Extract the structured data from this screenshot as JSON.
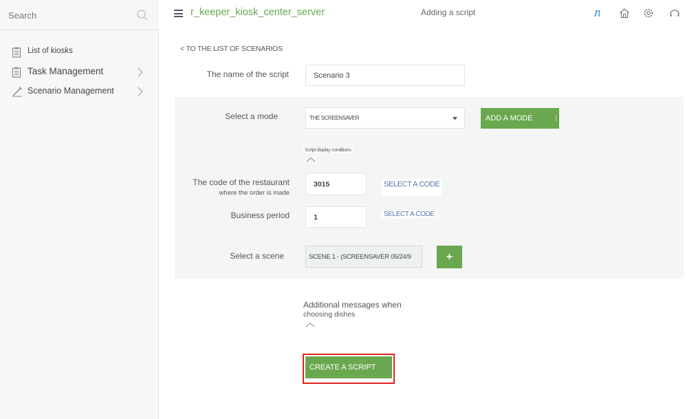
{
  "sidebar": {
    "search_placeholder": "Search",
    "items": [
      {
        "label": "List of kiosks",
        "icon": "clipboard-icon",
        "has_chevron": false
      },
      {
        "label": "Task Management",
        "icon": "clipboard-icon",
        "has_chevron": true
      },
      {
        "label": "Scenario Management",
        "icon": "pencil-icon",
        "has_chevron": true
      }
    ]
  },
  "header": {
    "app_title": "r_keeper_kiosk_center_server",
    "page_heading": "Adding a script",
    "language": "Л",
    "icons": [
      "home-icon",
      "settings-icon",
      "help-icon"
    ],
    "accent_color": "#6aa84f"
  },
  "form": {
    "back_link": "< TO THE LIST OF SCENARIOS",
    "script_name_label": "The name of the script",
    "script_name_value": "Scenario 3",
    "mode_label": "Select a mode",
    "mode_value": "THE SCREENSAVER",
    "add_mode_button": "ADD A MODE",
    "display_conditions_label": "Script display conditions",
    "restaurant_code_label": "The code of the restaurant",
    "restaurant_code_sublabel": "where the order is made",
    "restaurant_code_value": "3015",
    "select_code_1": "SELECT A CODE",
    "business_period_label": "Business period",
    "business_period_value": "1",
    "select_code_2": "SELECT A CODE",
    "scene_label": "Select a scene",
    "scene_value": "SCENE 1 - (SCREENSAVER 05/24/9",
    "add_scene_button": "+",
    "additional_messages_line1": "Additional messages when",
    "additional_messages_line2": "choosing dishes",
    "create_button": "CREATE A SCRIPT",
    "highlight_color": "#e0221c"
  }
}
